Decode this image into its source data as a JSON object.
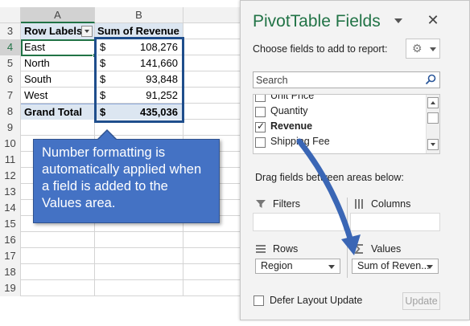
{
  "sheet": {
    "columns": [
      "A",
      "B"
    ],
    "rows": [
      {
        "num": "3",
        "a": "Row Labels",
        "cur": "",
        "amt": "",
        "b_text": "Sum of Revenue",
        "type": "header"
      },
      {
        "num": "4",
        "a": "East",
        "cur": "$",
        "amt": "108,276",
        "b_text": "",
        "type": "data"
      },
      {
        "num": "5",
        "a": "North",
        "cur": "$",
        "amt": "141,660",
        "b_text": "",
        "type": "data"
      },
      {
        "num": "6",
        "a": "South",
        "cur": "$",
        "amt": "93,848",
        "b_text": "",
        "type": "data"
      },
      {
        "num": "7",
        "a": "West",
        "cur": "$",
        "amt": "91,252",
        "b_text": "",
        "type": "data"
      },
      {
        "num": "8",
        "a": "Grand Total",
        "cur": "$",
        "amt": "435,036",
        "b_text": "",
        "type": "total"
      },
      {
        "num": "9"
      },
      {
        "num": "10"
      },
      {
        "num": "11"
      },
      {
        "num": "12"
      },
      {
        "num": "13"
      },
      {
        "num": "14"
      },
      {
        "num": "15"
      },
      {
        "num": "16"
      },
      {
        "num": "17"
      },
      {
        "num": "18"
      },
      {
        "num": "19"
      }
    ]
  },
  "callout": {
    "text": "Number formatting is automatically applied when a field is added to the Values area."
  },
  "pane": {
    "title": "PivotTable Fields",
    "close": "✕",
    "choose_label": "Choose fields to add to report:",
    "search_placeholder": "Search",
    "fields": [
      {
        "label": "Unit Price",
        "checked": false,
        "bold": false
      },
      {
        "label": "Quantity",
        "checked": false,
        "bold": false
      },
      {
        "label": "Revenue",
        "checked": true,
        "bold": true
      },
      {
        "label": "Shipping Fee",
        "checked": false,
        "bold": false
      }
    ],
    "drag_label": "Drag fields between areas below:",
    "areas": {
      "filters": "Filters",
      "columns": "Columns",
      "rows": "Rows",
      "values": "Values"
    },
    "rows_value": "Region",
    "values_value": "Sum of Reven...",
    "defer_label": "Defer Layout Update",
    "update_label": "Update"
  }
}
